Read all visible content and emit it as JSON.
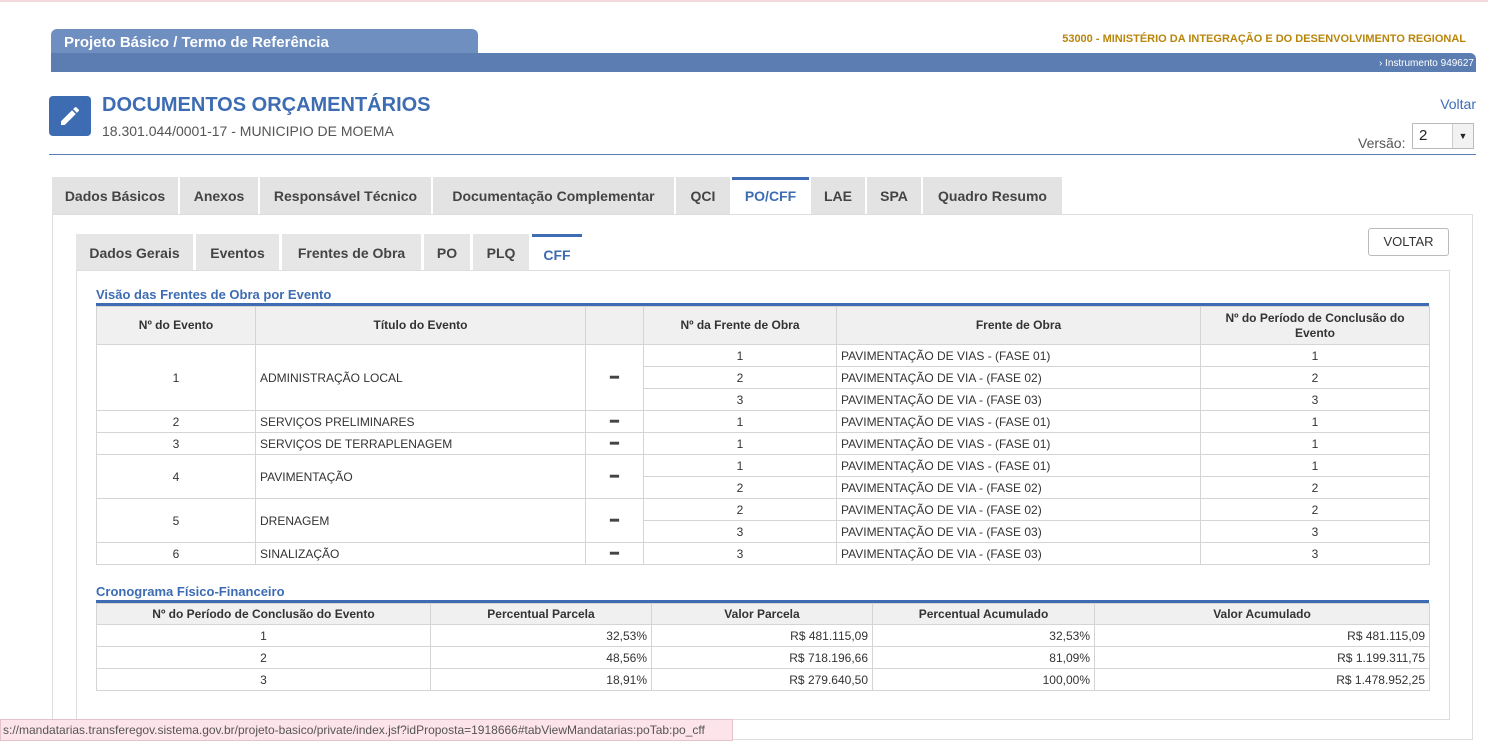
{
  "header": {
    "app_title": "Projeto Básico / Termo de Referência",
    "organization": "53000 - MINISTÉRIO DA INTEGRAÇÃO E DO DESENVOLVIMENTO REGIONAL",
    "instrument": "› Instrumento 949627"
  },
  "page": {
    "title": "DOCUMENTOS ORÇAMENTÁRIOS",
    "subtitle": "18.301.044/0001-17 - MUNICIPIO DE MOEMA",
    "voltar_link": "Voltar",
    "versao_label": "Versão:",
    "versao_value": "2"
  },
  "main_tabs": [
    "Dados Básicos",
    "Anexos",
    "Responsável Técnico",
    "Documentação Complementar",
    "QCI",
    "PO/CFF",
    "LAE",
    "SPA",
    "Quadro Resumo"
  ],
  "sub_tabs": [
    "Dados Gerais",
    "Eventos",
    "Frentes de Obra",
    "PO",
    "PLQ",
    "CFF"
  ],
  "voltar_button": "VOLTAR",
  "section1": {
    "title": "Visão das Frentes de Obra por Evento",
    "headers": [
      "Nº do Evento",
      "Título do Evento",
      "",
      "Nº da Frente de Obra",
      "Frente de Obra",
      "Nº do Período de Conclusão do Evento"
    ],
    "events": [
      {
        "num": "1",
        "title": "ADMINISTRAÇÃO LOCAL",
        "fronts": [
          {
            "num": "1",
            "name": "PAVIMENTAÇÃO DE VIAS - (FASE 01)",
            "period": "1"
          },
          {
            "num": "2",
            "name": "PAVIMENTAÇÃO DE VIA - (FASE 02)",
            "period": "2"
          },
          {
            "num": "3",
            "name": "PAVIMENTAÇÃO DE VIA - (FASE 03)",
            "period": "3"
          }
        ]
      },
      {
        "num": "2",
        "title": "SERVIÇOS PRELIMINARES",
        "fronts": [
          {
            "num": "1",
            "name": "PAVIMENTAÇÃO DE VIAS - (FASE 01)",
            "period": "1"
          }
        ]
      },
      {
        "num": "3",
        "title": "SERVIÇOS DE TERRAPLENAGEM",
        "fronts": [
          {
            "num": "1",
            "name": "PAVIMENTAÇÃO DE VIAS - (FASE 01)",
            "period": "1"
          }
        ]
      },
      {
        "num": "4",
        "title": "PAVIMENTAÇÃO",
        "fronts": [
          {
            "num": "1",
            "name": "PAVIMENTAÇÃO DE VIAS - (FASE 01)",
            "period": "1"
          },
          {
            "num": "2",
            "name": "PAVIMENTAÇÃO DE VIA - (FASE 02)",
            "period": "2"
          }
        ]
      },
      {
        "num": "5",
        "title": "DRENAGEM",
        "fronts": [
          {
            "num": "2",
            "name": "PAVIMENTAÇÃO DE VIA - (FASE 02)",
            "period": "2"
          },
          {
            "num": "3",
            "name": "PAVIMENTAÇÃO DE VIA - (FASE 03)",
            "period": "3"
          }
        ]
      },
      {
        "num": "6",
        "title": "SINALIZAÇÃO",
        "fronts": [
          {
            "num": "3",
            "name": "PAVIMENTAÇÃO DE VIA - (FASE 03)",
            "period": "3"
          }
        ]
      }
    ]
  },
  "section2": {
    "title": "Cronograma Físico-Financeiro",
    "headers": [
      "Nº do Período de Conclusão do Evento",
      "Percentual Parcela",
      "Valor Parcela",
      "Percentual Acumulado",
      "Valor Acumulado"
    ],
    "rows": [
      [
        "1",
        "32,53%",
        "R$ 481.115,09",
        "32,53%",
        "R$ 481.115,09"
      ],
      [
        "2",
        "48,56%",
        "R$ 718.196,66",
        "81,09%",
        "R$ 1.199.311,75"
      ],
      [
        "3",
        "18,91%",
        "R$ 279.640,50",
        "100,00%",
        "R$ 1.478.952,25"
      ]
    ]
  },
  "status_url": "s://mandatarias.transferegov.sistema.gov.br/projeto-basico/private/index.jsf?idProposta=1918666#tabViewMandatarias:poTab:po_cff",
  "colors": {
    "accent": "#3d6cb3",
    "header_bar": "#5b7db2",
    "org_text": "#b8860b"
  },
  "icons": {
    "edit": "pencil-icon",
    "select": "chevron-down-icon",
    "row_action": "minus-icon"
  }
}
